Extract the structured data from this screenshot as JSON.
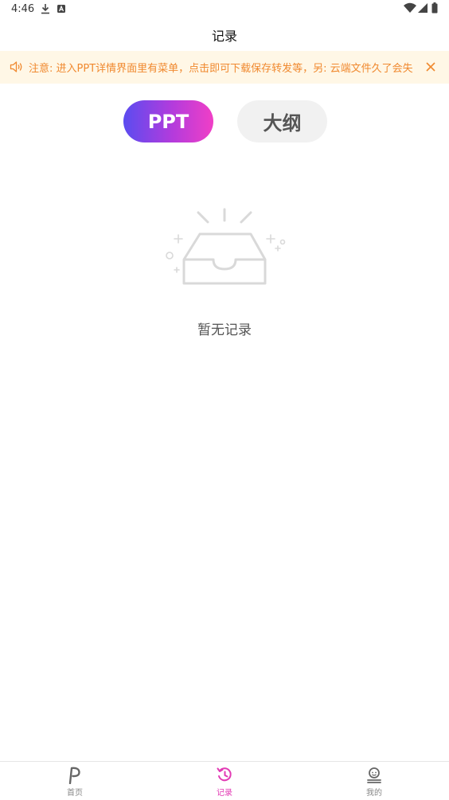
{
  "status_bar": {
    "time": "4:46"
  },
  "header": {
    "title": "记录"
  },
  "notice": {
    "text": "注意: 进入PPT详情界面里有菜单，点击即可下载保存转发等，另:  云端文件久了会失"
  },
  "segments": {
    "ppt": "PPT",
    "outline": "大纲"
  },
  "empty_state": {
    "text": "暂无记录"
  },
  "bottom_nav": {
    "items": [
      {
        "label": "首页",
        "icon": "home-p-icon"
      },
      {
        "label": "记录",
        "icon": "history-icon",
        "active": true
      },
      {
        "label": "我的",
        "icon": "profile-icon"
      }
    ]
  },
  "colors": {
    "accent": "#e23bb4",
    "notice_text": "#f0892f",
    "notice_bg": "#fff7e6",
    "gradient_start": "#5b4cf0",
    "gradient_end": "#f03fc6"
  }
}
